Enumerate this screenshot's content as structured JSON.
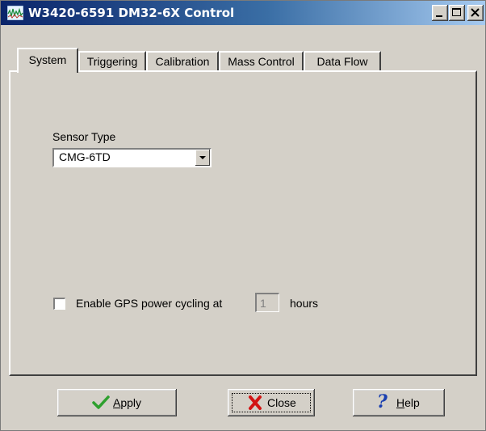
{
  "window": {
    "title": "W3420-6591 DM32-6X Control",
    "controls": {
      "minimize": "_",
      "maximize": "□",
      "close": "×"
    }
  },
  "tabs": [
    {
      "label": "System",
      "active": true
    },
    {
      "label": "Triggering",
      "active": false
    },
    {
      "label": "Calibration",
      "active": false
    },
    {
      "label": "Mass Control",
      "active": false
    },
    {
      "label": "Data Flow",
      "active": false
    }
  ],
  "system": {
    "sensor_type_label": "Sensor Type",
    "sensor_type_value": "CMG-6TD",
    "gps_checkbox_label": "Enable GPS power cycling at",
    "gps_checked": false,
    "gps_hours_value": "1",
    "gps_hours_suffix": "hours"
  },
  "buttons": {
    "apply": {
      "underline": "A",
      "rest": "pply"
    },
    "close": {
      "label": "Close"
    },
    "help": {
      "underline": "H",
      "rest": "elp"
    }
  },
  "colors": {
    "titlebar_start": "#0a246a",
    "titlebar_end": "#a6caf0",
    "face": "#d4d0c8",
    "apply_check": "#2ea02e",
    "close_x": "#d21414",
    "help_question": "#1a3fb0"
  },
  "icons": {
    "app": "waveform-icon",
    "apply": "checkmark-icon",
    "close": "red-x-icon",
    "help": "question-mark-icon",
    "combo": "chevron-down-icon"
  }
}
